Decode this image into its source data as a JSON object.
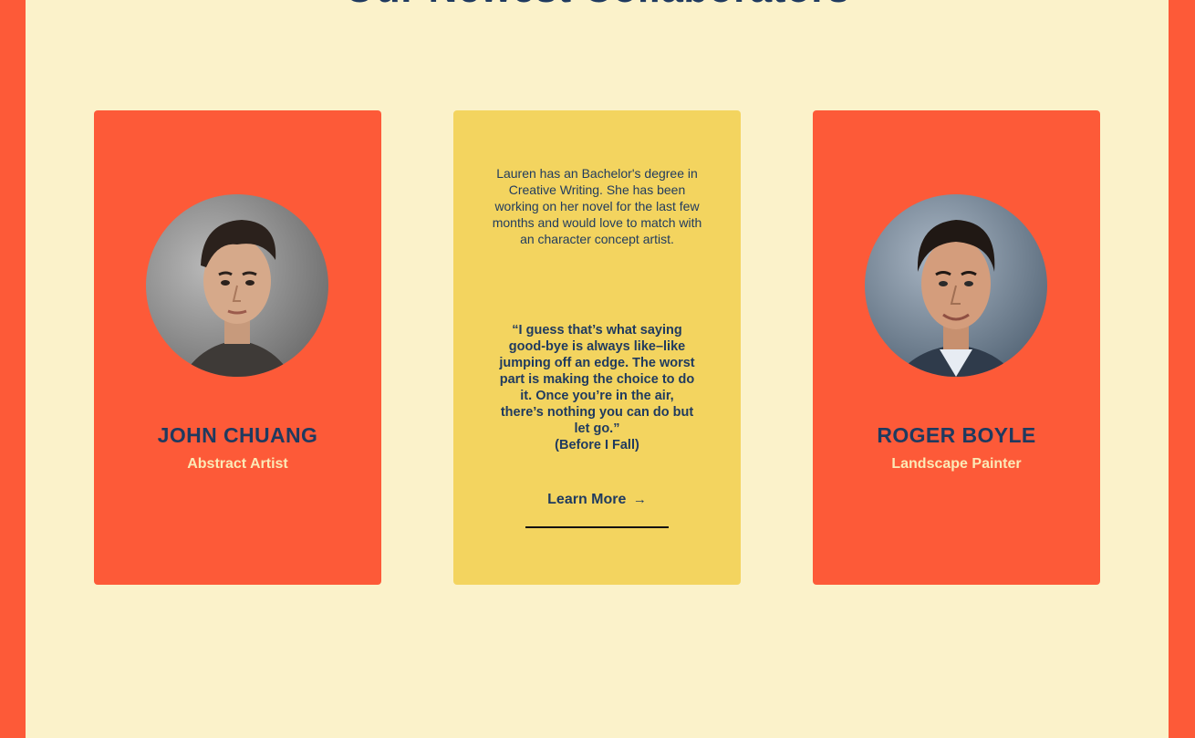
{
  "section": {
    "title": "Our Newest Collaborators"
  },
  "colors": {
    "page_bg": "#FBF2CA",
    "accent_orange": "#FD5A38",
    "accent_yellow": "#F3D45F",
    "navy": "#1F3A5F",
    "cream_text": "#FBE9B6"
  },
  "cards": [
    {
      "name": "JOHN CHUANG",
      "role": "Abstract Artist"
    },
    {
      "bio": "Lauren has an Bachelor's degree in Creative Writing. She has been working on her novel for the last few months and would love to match with an character concept artist.",
      "quote": "“I guess that’s what saying good-bye is always like–like jumping off an edge. The worst part is making the choice to do it. Once you’re in the air, there’s nothing you can do but let go.”",
      "source": "(Before I Fall)",
      "link_label": "Learn More",
      "link_icon": "→"
    },
    {
      "name": "ROGER BOYLE",
      "role": "Landscape Painter"
    }
  ]
}
